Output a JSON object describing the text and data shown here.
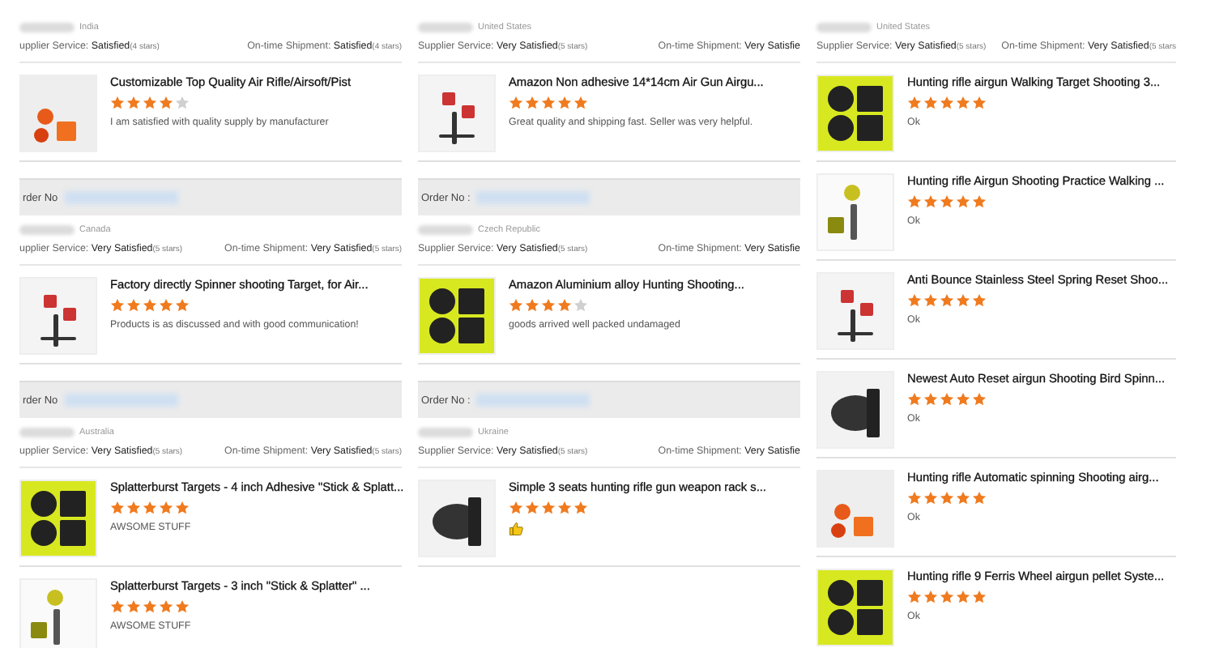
{
  "columns": [
    {
      "blocks": [
        {
          "kind": "meta",
          "country": "India",
          "supplier_label": "upplier Service:",
          "supplier_value": "Satisfied",
          "supplier_stars": "(4 stars)",
          "shipment_label": "On-time Shipment:",
          "shipment_value": "Satisfied",
          "shipment_stars": "(4 stars)"
        },
        {
          "kind": "item",
          "title": "Customizable Top Quality Air Rifle/Airsoft/Pist",
          "stars": 4,
          "review": {
            "kind": "text",
            "text": "I am satisfied with quality supply by manufacturer"
          }
        },
        {
          "kind": "order",
          "label": "rder No"
        },
        {
          "kind": "meta",
          "country": "Canada",
          "supplier_label": "upplier Service:",
          "supplier_value": "Very Satisfied",
          "supplier_stars": "(5 stars)",
          "shipment_label": "On-time Shipment:",
          "shipment_value": "Very Satisfied",
          "shipment_stars": "(5 stars)"
        },
        {
          "kind": "item",
          "title": "Factory directly Spinner shooting Target, for Air...",
          "stars": 5,
          "review": {
            "kind": "text",
            "text": "Products is as discussed and with good communication!"
          }
        },
        {
          "kind": "order",
          "label": "rder No"
        },
        {
          "kind": "meta",
          "country": "Australia",
          "supplier_label": "upplier Service:",
          "supplier_value": "Very Satisfied",
          "supplier_stars": "(5 stars)",
          "shipment_label": "On-time Shipment:",
          "shipment_value": "Very Satisfied",
          "shipment_stars": "(5 stars)"
        },
        {
          "kind": "item",
          "title": "Splatterburst Targets - 4 inch Adhesive \"Stick & Splatt...",
          "stars": 5,
          "review": {
            "kind": "text",
            "text": "AWSOME STUFF"
          }
        },
        {
          "kind": "item",
          "title": "Splatterburst Targets - 3 inch \"Stick & Splatter\" ...",
          "stars": 5,
          "review": {
            "kind": "text",
            "text": "AWSOME STUFF"
          }
        }
      ]
    },
    {
      "blocks": [
        {
          "kind": "meta",
          "country": "United States",
          "supplier_label": "Supplier Service:",
          "supplier_value": "Very Satisfied",
          "supplier_stars": "(5 stars)",
          "shipment_label": "On-time Shipment:",
          "shipment_value": "Very Satisfie"
        },
        {
          "kind": "item",
          "title": "Amazon Non adhesive 14*14cm Air Gun Airgu...",
          "stars": 5,
          "review": {
            "kind": "text",
            "text": "Great quality and shipping fast. Seller was very helpful."
          }
        },
        {
          "kind": "order",
          "label": "Order No :"
        },
        {
          "kind": "meta",
          "country": "Czech Republic",
          "supplier_label": "Supplier Service:",
          "supplier_value": "Very Satisfied",
          "supplier_stars": "(5 stars)",
          "shipment_label": "On-time Shipment:",
          "shipment_value": "Very Satisfie"
        },
        {
          "kind": "item",
          "title": "Amazon Aluminium alloy Hunting Shooting...",
          "stars": 4,
          "review": {
            "kind": "text",
            "text": "goods arrived well packed undamaged"
          }
        },
        {
          "kind": "order",
          "label": "Order No :"
        },
        {
          "kind": "meta",
          "country": "Ukraine",
          "supplier_label": "Supplier Service:",
          "supplier_value": "Very Satisfied",
          "supplier_stars": "(5 stars)",
          "shipment_label": "On-time Shipment:",
          "shipment_value": "Very Satisfie"
        },
        {
          "kind": "item",
          "title": "Simple 3 seats hunting rifle gun weapon rack s...",
          "stars": 5,
          "review": {
            "kind": "thumbs-up"
          }
        }
      ]
    },
    {
      "blocks": [
        {
          "kind": "meta",
          "country": "United States",
          "supplier_label": "Supplier Service:",
          "supplier_value": "Very Satisfied",
          "supplier_stars": "(5 stars)",
          "shipment_label": "On-time Shipment:",
          "shipment_value": "Very Satisfied",
          "shipment_stars": "(5 stars"
        },
        {
          "kind": "item",
          "title": "Hunting rifle airgun Walking Target Shooting 3...",
          "stars": 5,
          "review": {
            "kind": "text",
            "text": "Ok"
          }
        },
        {
          "kind": "item",
          "title": "Hunting rifle Airgun Shooting Practice Walking ...",
          "stars": 5,
          "review": {
            "kind": "text",
            "text": "Ok"
          }
        },
        {
          "kind": "item",
          "title": "Anti Bounce Stainless Steel Spring Reset Shoo...",
          "stars": 5,
          "review": {
            "kind": "text",
            "text": "Ok"
          }
        },
        {
          "kind": "item",
          "title": "Newest Auto Reset airgun Shooting Bird Spinn...",
          "stars": 5,
          "review": {
            "kind": "text",
            "text": "Ok"
          }
        },
        {
          "kind": "item",
          "title": "Hunting rifle Automatic spinning Shooting airg...",
          "stars": 5,
          "review": {
            "kind": "text",
            "text": "Ok"
          }
        },
        {
          "kind": "item",
          "title": "Hunting rifle 9 Ferris Wheel airgun pellet Syste...",
          "stars": 5,
          "review": {
            "kind": "text",
            "text": "Ok"
          }
        }
      ]
    }
  ]
}
